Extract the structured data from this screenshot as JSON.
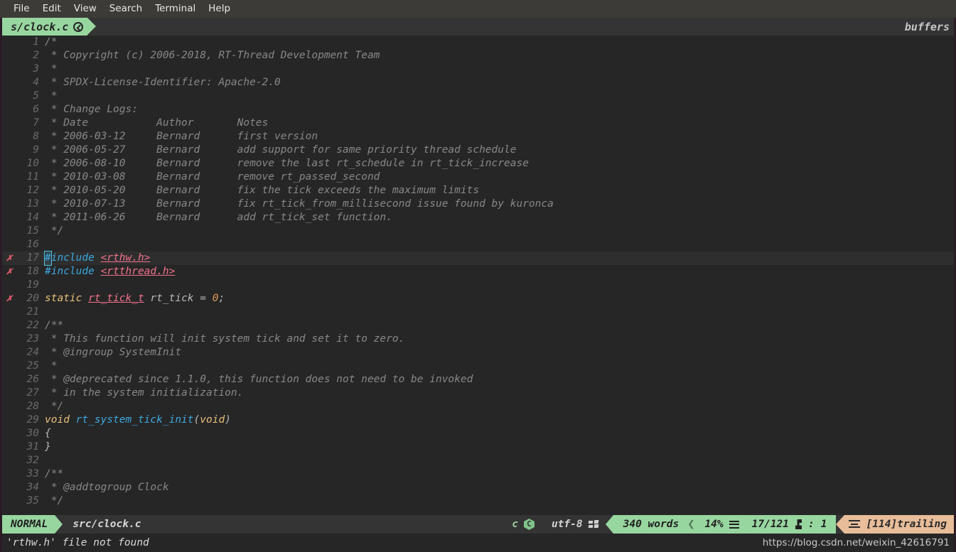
{
  "menubar": {
    "items": [
      "File",
      "Edit",
      "View",
      "Search",
      "Terminal",
      "Help"
    ]
  },
  "tabline": {
    "active_tab": "s/clock.c",
    "active_tab_icon": "git-circle-icon",
    "right_label": "buffers",
    "accent_color": "#98d6a0"
  },
  "editor": {
    "lines": [
      {
        "num": "1",
        "sign": "",
        "current": false,
        "segments": [
          {
            "t": "/*",
            "c": "c-comment"
          }
        ]
      },
      {
        "num": "2",
        "sign": "",
        "current": false,
        "segments": [
          {
            "t": " * Copyright (c) 2006-2018, RT-Thread Development Team",
            "c": "c-comment"
          }
        ]
      },
      {
        "num": "3",
        "sign": "",
        "current": false,
        "segments": [
          {
            "t": " *",
            "c": "c-comment"
          }
        ]
      },
      {
        "num": "4",
        "sign": "",
        "current": false,
        "segments": [
          {
            "t": " * SPDX-License-Identifier: Apache-2.0",
            "c": "c-comment"
          }
        ]
      },
      {
        "num": "5",
        "sign": "",
        "current": false,
        "segments": [
          {
            "t": " *",
            "c": "c-comment"
          }
        ]
      },
      {
        "num": "6",
        "sign": "",
        "current": false,
        "segments": [
          {
            "t": " * Change Logs:",
            "c": "c-comment"
          }
        ]
      },
      {
        "num": "7",
        "sign": "",
        "current": false,
        "segments": [
          {
            "t": " * Date           Author       Notes",
            "c": "c-comment"
          }
        ]
      },
      {
        "num": "8",
        "sign": "",
        "current": false,
        "segments": [
          {
            "t": " * 2006-03-12     Bernard      first version",
            "c": "c-comment"
          }
        ]
      },
      {
        "num": "9",
        "sign": "",
        "current": false,
        "segments": [
          {
            "t": " * 2006-05-27     Bernard      add support for same priority thread schedule",
            "c": "c-comment"
          }
        ]
      },
      {
        "num": "10",
        "sign": "",
        "current": false,
        "segments": [
          {
            "t": " * 2006-08-10     Bernard      remove the last rt_schedule in rt_tick_increase",
            "c": "c-comment"
          }
        ]
      },
      {
        "num": "11",
        "sign": "",
        "current": false,
        "segments": [
          {
            "t": " * 2010-03-08     Bernard      remove rt_passed_second",
            "c": "c-comment"
          }
        ]
      },
      {
        "num": "12",
        "sign": "",
        "current": false,
        "segments": [
          {
            "t": " * 2010-05-20     Bernard      fix the tick exceeds the maximum limits",
            "c": "c-comment"
          }
        ]
      },
      {
        "num": "13",
        "sign": "",
        "current": false,
        "segments": [
          {
            "t": " * 2010-07-13     Bernard      fix rt_tick_from_millisecond issue found by kuronca",
            "c": "c-comment"
          }
        ]
      },
      {
        "num": "14",
        "sign": "",
        "current": false,
        "segments": [
          {
            "t": " * 2011-06-26     Bernard      add rt_tick_set function.",
            "c": "c-comment"
          }
        ]
      },
      {
        "num": "15",
        "sign": "",
        "current": false,
        "segments": [
          {
            "t": " */",
            "c": "c-comment"
          }
        ]
      },
      {
        "num": "16",
        "sign": "",
        "current": false,
        "segments": []
      },
      {
        "num": "17",
        "sign": "✗",
        "current": true,
        "segments": [
          {
            "t": "#",
            "c": "c-pre",
            "cursor": true
          },
          {
            "t": "include ",
            "c": "c-pre"
          },
          {
            "t": "<rthw.h>",
            "c": "c-err"
          }
        ]
      },
      {
        "num": "18",
        "sign": "✗",
        "current": false,
        "segments": [
          {
            "t": "#include ",
            "c": "c-pre"
          },
          {
            "t": "<rtthread.h>",
            "c": "c-err"
          }
        ]
      },
      {
        "num": "19",
        "sign": "",
        "current": false,
        "segments": []
      },
      {
        "num": "20",
        "sign": "✗",
        "current": false,
        "segments": [
          {
            "t": "static ",
            "c": "c-type"
          },
          {
            "t": "rt_tick_t",
            "c": "c-typeerr"
          },
          {
            "t": " rt_tick ",
            "c": "c-ident"
          },
          {
            "t": "= ",
            "c": "c-punct"
          },
          {
            "t": "0",
            "c": "c-num"
          },
          {
            "t": ";",
            "c": "c-punct"
          }
        ]
      },
      {
        "num": "21",
        "sign": "",
        "current": false,
        "segments": []
      },
      {
        "num": "22",
        "sign": "",
        "current": false,
        "segments": [
          {
            "t": "/**",
            "c": "c-comment"
          }
        ]
      },
      {
        "num": "23",
        "sign": "",
        "current": false,
        "segments": [
          {
            "t": " * This function will init system tick and set it to zero.",
            "c": "c-comment"
          }
        ]
      },
      {
        "num": "24",
        "sign": "",
        "current": false,
        "segments": [
          {
            "t": " * @ingroup SystemInit",
            "c": "c-comment"
          }
        ]
      },
      {
        "num": "25",
        "sign": "",
        "current": false,
        "segments": [
          {
            "t": " *",
            "c": "c-comment"
          }
        ]
      },
      {
        "num": "26",
        "sign": "",
        "current": false,
        "segments": [
          {
            "t": " * @deprecated since 1.1.0, this function does not need to be invoked",
            "c": "c-comment"
          }
        ]
      },
      {
        "num": "27",
        "sign": "",
        "current": false,
        "segments": [
          {
            "t": " * in the system initialization.",
            "c": "c-comment"
          }
        ]
      },
      {
        "num": "28",
        "sign": "",
        "current": false,
        "segments": [
          {
            "t": " */",
            "c": "c-comment"
          }
        ]
      },
      {
        "num": "29",
        "sign": "",
        "current": false,
        "segments": [
          {
            "t": "void ",
            "c": "c-kw"
          },
          {
            "t": "rt_system_tick_init",
            "c": "c-func"
          },
          {
            "t": "(",
            "c": "c-punct"
          },
          {
            "t": "void",
            "c": "c-kw"
          },
          {
            "t": ")",
            "c": "c-punct"
          }
        ]
      },
      {
        "num": "30",
        "sign": "",
        "current": false,
        "segments": [
          {
            "t": "{",
            "c": "c-brace"
          }
        ]
      },
      {
        "num": "31",
        "sign": "",
        "current": false,
        "segments": [
          {
            "t": "}",
            "c": "c-brace"
          }
        ]
      },
      {
        "num": "32",
        "sign": "",
        "current": false,
        "segments": []
      },
      {
        "num": "33",
        "sign": "",
        "current": false,
        "segments": [
          {
            "t": "/**",
            "c": "c-comment"
          }
        ]
      },
      {
        "num": "34",
        "sign": "",
        "current": false,
        "segments": [
          {
            "t": " * @addtogroup Clock",
            "c": "c-comment"
          }
        ]
      },
      {
        "num": "35",
        "sign": "",
        "current": false,
        "segments": [
          {
            "t": " */",
            "c": "c-comment"
          }
        ]
      }
    ]
  },
  "statusline": {
    "mode": "NORMAL",
    "file_path": "src/clock.c",
    "filetype": "c",
    "filetype_icon": "c-language-icon",
    "encoding": "utf-8",
    "encoding_icon": "windows-fileformat-icon",
    "word_count": "340 words",
    "percent": "14%",
    "percent_icon": "hamburger-icon",
    "position": "17/121",
    "position_icon": "line-number-icon",
    "column_sep": ":",
    "column": "1",
    "trailing": "[114]trailing",
    "trailing_icon": "trailing-whitespace-icon",
    "mode_color": "#98d6a0",
    "trailing_color": "#e8bd99"
  },
  "message": {
    "text": "'rthw.h' file not found",
    "watermark": "https://blog.csdn.net/weixin_42616791"
  }
}
